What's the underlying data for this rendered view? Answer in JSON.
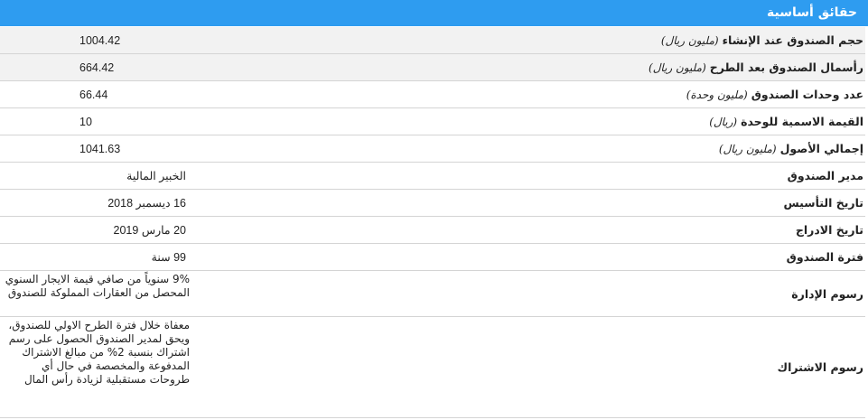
{
  "header": {
    "title": "حقائق أساسية"
  },
  "rows": [
    {
      "label": "حجم الصندوق عند الإنشاء",
      "unit": "(مليون ريال)",
      "value": "1004.42"
    },
    {
      "label": "رأسمال الصندوق بعد الطرح",
      "unit": "(مليون ريال)",
      "value": "664.42"
    },
    {
      "label": "عدد وحدات الصندوق",
      "unit": "(مليون وحدة)",
      "value": "66.44"
    },
    {
      "label": "القيمة الاسمية للوحدة",
      "unit": "(ريال)",
      "value": "10"
    },
    {
      "label": "إجمالي الأصول",
      "unit": "(مليون ريال)",
      "value": "1041.63"
    },
    {
      "label": "مدير الصندوق",
      "value": "الخبير المالية"
    },
    {
      "label": "تاريخ التأسيس",
      "value": "16 ديسمبر 2018"
    },
    {
      "label": "تاريخ الادراج",
      "value": "20 مارس 2019"
    },
    {
      "label": "فترة الصندوق",
      "value": "99 سنة"
    },
    {
      "label": "رسوم الإدارة",
      "value": "9% سنوياً من صافي قيمة الايجار السنوي المحصل من العقارات المملوكة للصندوق"
    },
    {
      "label": "رسوم الاشتراك",
      "value": "معفاة خلال فترة الطرح الاولي للصندوق، ويحق لمدير الصندوق الحصول على رسم اشتراك بنسبة 2% من مبالغ الاشتراك المدفوعة والمخصصة في حال أي طروحات مستقبلية لزيادة رأس المال"
    }
  ],
  "colors": {
    "header_bg": "#2e9cf0",
    "row_shade": "#f2f2f2",
    "divider": "#d4d4d4"
  }
}
